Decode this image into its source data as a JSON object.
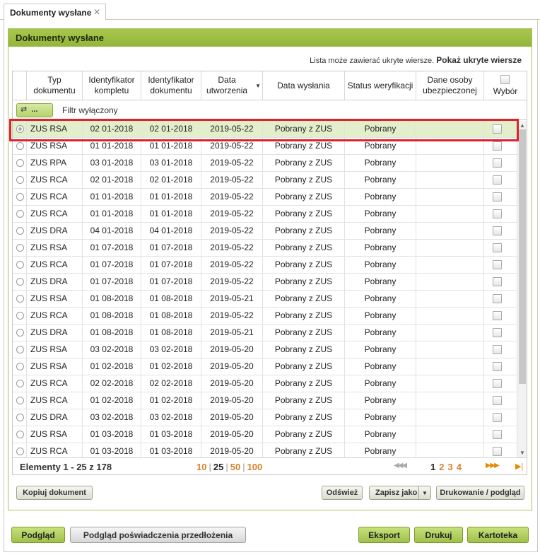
{
  "tab": {
    "label": "Dokumenty wysłane",
    "close": "✕"
  },
  "panel": {
    "title": "Dokumenty wysłane"
  },
  "hidden_note": {
    "text": "Lista może zawierać ukryte wiersze.",
    "link": "Pokaż ukryte wiersze"
  },
  "columns": [
    "Typ dokumentu",
    "Identyfikator kompletu",
    "Identyfikator dokumentu",
    "Data utworzenia",
    "Data wysłania",
    "Status weryfikacji",
    "Dane osoby ubezpieczonej",
    "Wybór"
  ],
  "filter": {
    "button_dots": "...",
    "label": "Filtr wyłączony"
  },
  "rows": [
    {
      "type": "ZUS RSA",
      "set": "02 01-2018",
      "doc": "02 01-2018",
      "created": "2019-05-22",
      "sent": "Pobrany z ZUS",
      "status": "Pobrany",
      "insured": ""
    },
    {
      "type": "ZUS RSA",
      "set": "01 01-2018",
      "doc": "01 01-2018",
      "created": "2019-05-22",
      "sent": "Pobrany z ZUS",
      "status": "Pobrany",
      "insured": ""
    },
    {
      "type": "ZUS RPA",
      "set": "03 01-2018",
      "doc": "03 01-2018",
      "created": "2019-05-22",
      "sent": "Pobrany z ZUS",
      "status": "Pobrany",
      "insured": ""
    },
    {
      "type": "ZUS RCA",
      "set": "02 01-2018",
      "doc": "02 01-2018",
      "created": "2019-05-22",
      "sent": "Pobrany z ZUS",
      "status": "Pobrany",
      "insured": ""
    },
    {
      "type": "ZUS RCA",
      "set": "01 01-2018",
      "doc": "01 01-2018",
      "created": "2019-05-22",
      "sent": "Pobrany z ZUS",
      "status": "Pobrany",
      "insured": ""
    },
    {
      "type": "ZUS RCA",
      "set": "01 01-2018",
      "doc": "01 01-2018",
      "created": "2019-05-22",
      "sent": "Pobrany z ZUS",
      "status": "Pobrany",
      "insured": ""
    },
    {
      "type": "ZUS DRA",
      "set": "04 01-2018",
      "doc": "04 01-2018",
      "created": "2019-05-22",
      "sent": "Pobrany z ZUS",
      "status": "Pobrany",
      "insured": ""
    },
    {
      "type": "ZUS RSA",
      "set": "01 07-2018",
      "doc": "01 07-2018",
      "created": "2019-05-22",
      "sent": "Pobrany z ZUS",
      "status": "Pobrany",
      "insured": ""
    },
    {
      "type": "ZUS RCA",
      "set": "01 07-2018",
      "doc": "01 07-2018",
      "created": "2019-05-22",
      "sent": "Pobrany z ZUS",
      "status": "Pobrany",
      "insured": ""
    },
    {
      "type": "ZUS DRA",
      "set": "01 07-2018",
      "doc": "01 07-2018",
      "created": "2019-05-22",
      "sent": "Pobrany z ZUS",
      "status": "Pobrany",
      "insured": ""
    },
    {
      "type": "ZUS RSA",
      "set": "01 08-2018",
      "doc": "01 08-2018",
      "created": "2019-05-21",
      "sent": "Pobrany z ZUS",
      "status": "Pobrany",
      "insured": ""
    },
    {
      "type": "ZUS RCA",
      "set": "01 08-2018",
      "doc": "01 08-2018",
      "created": "2019-05-22",
      "sent": "Pobrany z ZUS",
      "status": "Pobrany",
      "insured": ""
    },
    {
      "type": "ZUS DRA",
      "set": "01 08-2018",
      "doc": "01 08-2018",
      "created": "2019-05-21",
      "sent": "Pobrany z ZUS",
      "status": "Pobrany",
      "insured": ""
    },
    {
      "type": "ZUS RSA",
      "set": "03 02-2018",
      "doc": "03 02-2018",
      "created": "2019-05-20",
      "sent": "Pobrany z ZUS",
      "status": "Pobrany",
      "insured": ""
    },
    {
      "type": "ZUS RSA",
      "set": "01 02-2018",
      "doc": "01 02-2018",
      "created": "2019-05-20",
      "sent": "Pobrany z ZUS",
      "status": "Pobrany",
      "insured": ""
    },
    {
      "type": "ZUS RCA",
      "set": "02 02-2018",
      "doc": "02 02-2018",
      "created": "2019-05-20",
      "sent": "Pobrany z ZUS",
      "status": "Pobrany",
      "insured": ""
    },
    {
      "type": "ZUS RCA",
      "set": "01 02-2018",
      "doc": "01 02-2018",
      "created": "2019-05-20",
      "sent": "Pobrany z ZUS",
      "status": "Pobrany",
      "insured": ""
    },
    {
      "type": "ZUS DRA",
      "set": "03 02-2018",
      "doc": "03 02-2018",
      "created": "2019-05-20",
      "sent": "Pobrany z ZUS",
      "status": "Pobrany",
      "insured": ""
    },
    {
      "type": "ZUS RSA",
      "set": "01 03-2018",
      "doc": "01 03-2018",
      "created": "2019-05-20",
      "sent": "Pobrany z ZUS",
      "status": "Pobrany",
      "insured": ""
    },
    {
      "type": "ZUS RCA",
      "set": "01 03-2018",
      "doc": "01 03-2018",
      "created": "2019-05-20",
      "sent": "Pobrany z ZUS",
      "status": "Pobrany",
      "insured": ""
    }
  ],
  "selected_row": 0,
  "pager": {
    "count": "Elementy 1 - 25 z 178",
    "sizes": [
      "10",
      "25",
      "50",
      "100"
    ],
    "current_size": "25",
    "pages": [
      "1",
      "2",
      "3",
      "4"
    ],
    "current_page": "1"
  },
  "grid_buttons": {
    "copy": "Kopiuj dokument",
    "refresh": "Odśwież",
    "save_as": "Zapisz jako",
    "print_preview": "Drukowanie / podgląd"
  },
  "bottom_buttons": {
    "preview": "Podgląd",
    "preview_confirmation": "Podgląd poświadczenia przedłożenia",
    "export": "Eksport",
    "print": "Drukuj",
    "card": "Kartoteka"
  },
  "colors": {
    "accent_green": "#9ec14a",
    "selected_row": "#e3efcb",
    "highlight_red": "#e0202a",
    "pager_link": "#d9822b"
  }
}
